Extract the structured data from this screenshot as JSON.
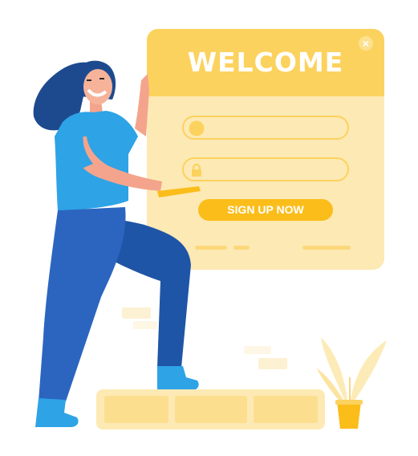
{
  "card": {
    "title": "WELCOME",
    "close_icon": "close-icon",
    "username_icon": "user-icon",
    "password_icon": "lock-icon",
    "username_value": "",
    "password_value": "",
    "signup_label": "SIGN UP NOW"
  },
  "colors": {
    "header": "#fcd25e",
    "card_body": "#fde9b4",
    "button": "#fbbd1a",
    "shirt": "#2ea3e6",
    "pants": "#2b5fb0",
    "hair": "#1d4a8f"
  }
}
